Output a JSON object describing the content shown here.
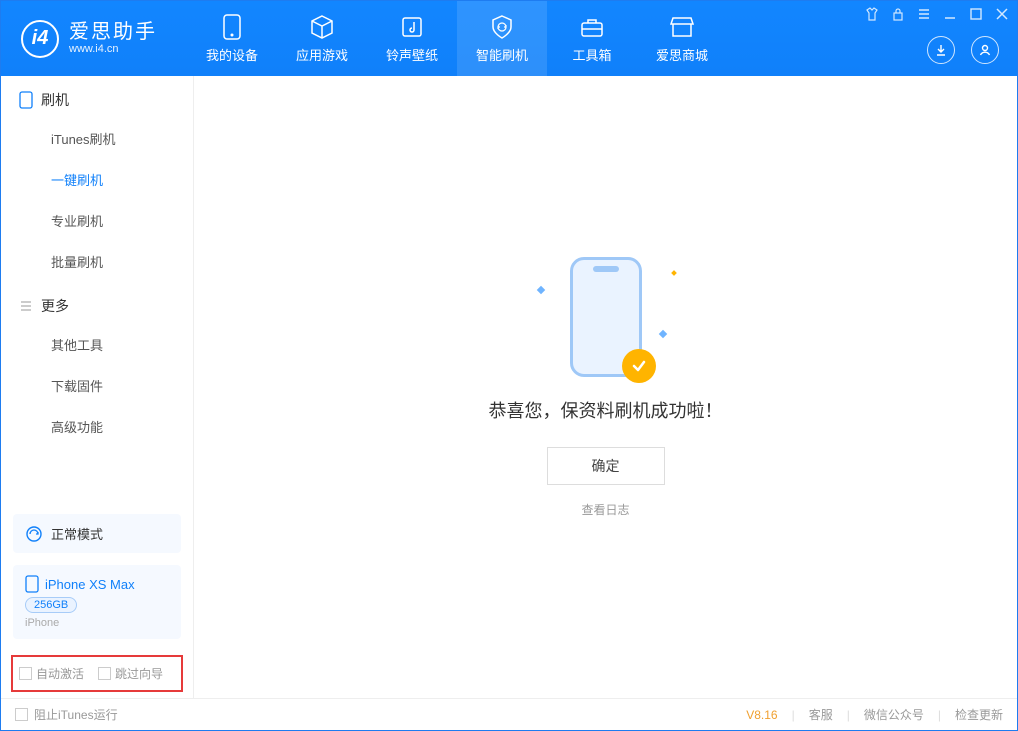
{
  "app": {
    "name": "爱思助手",
    "url": "www.i4.cn"
  },
  "nav": {
    "tabs": [
      {
        "label": "我的设备"
      },
      {
        "label": "应用游戏"
      },
      {
        "label": "铃声壁纸"
      },
      {
        "label": "智能刷机"
      },
      {
        "label": "工具箱"
      },
      {
        "label": "爱思商城"
      }
    ]
  },
  "sidebar": {
    "section1_title": "刷机",
    "section1_items": [
      {
        "label": "iTunes刷机"
      },
      {
        "label": "一键刷机"
      },
      {
        "label": "专业刷机"
      },
      {
        "label": "批量刷机"
      }
    ],
    "section2_title": "更多",
    "section2_items": [
      {
        "label": "其他工具"
      },
      {
        "label": "下载固件"
      },
      {
        "label": "高级功能"
      }
    ],
    "mode_label": "正常模式",
    "device": {
      "name": "iPhone XS Max",
      "capacity": "256GB",
      "type": "iPhone"
    },
    "checkbox1": "自动激活",
    "checkbox2": "跳过向导"
  },
  "main": {
    "success_message": "恭喜您，保资料刷机成功啦！",
    "ok_button": "确定",
    "view_log": "查看日志"
  },
  "status": {
    "block_itunes": "阻止iTunes运行",
    "version": "V8.16",
    "links": [
      "客服",
      "微信公众号",
      "检查更新"
    ]
  }
}
